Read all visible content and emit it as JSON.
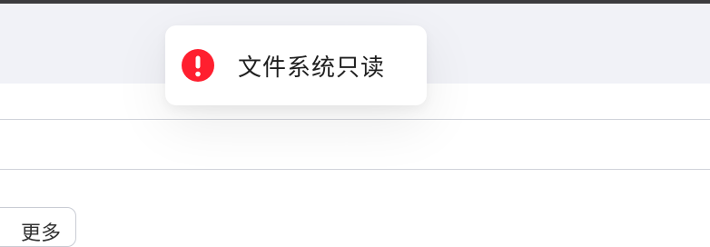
{
  "toast": {
    "icon": "error-exclamation-icon",
    "message": "文件系统只读",
    "icon_color": "#ff1f2f"
  },
  "toolbar": {
    "more_label": "更多"
  },
  "colors": {
    "top_border": "#3c3c3e",
    "header_background": "#f1f2f7",
    "divider": "#d0d3da"
  }
}
